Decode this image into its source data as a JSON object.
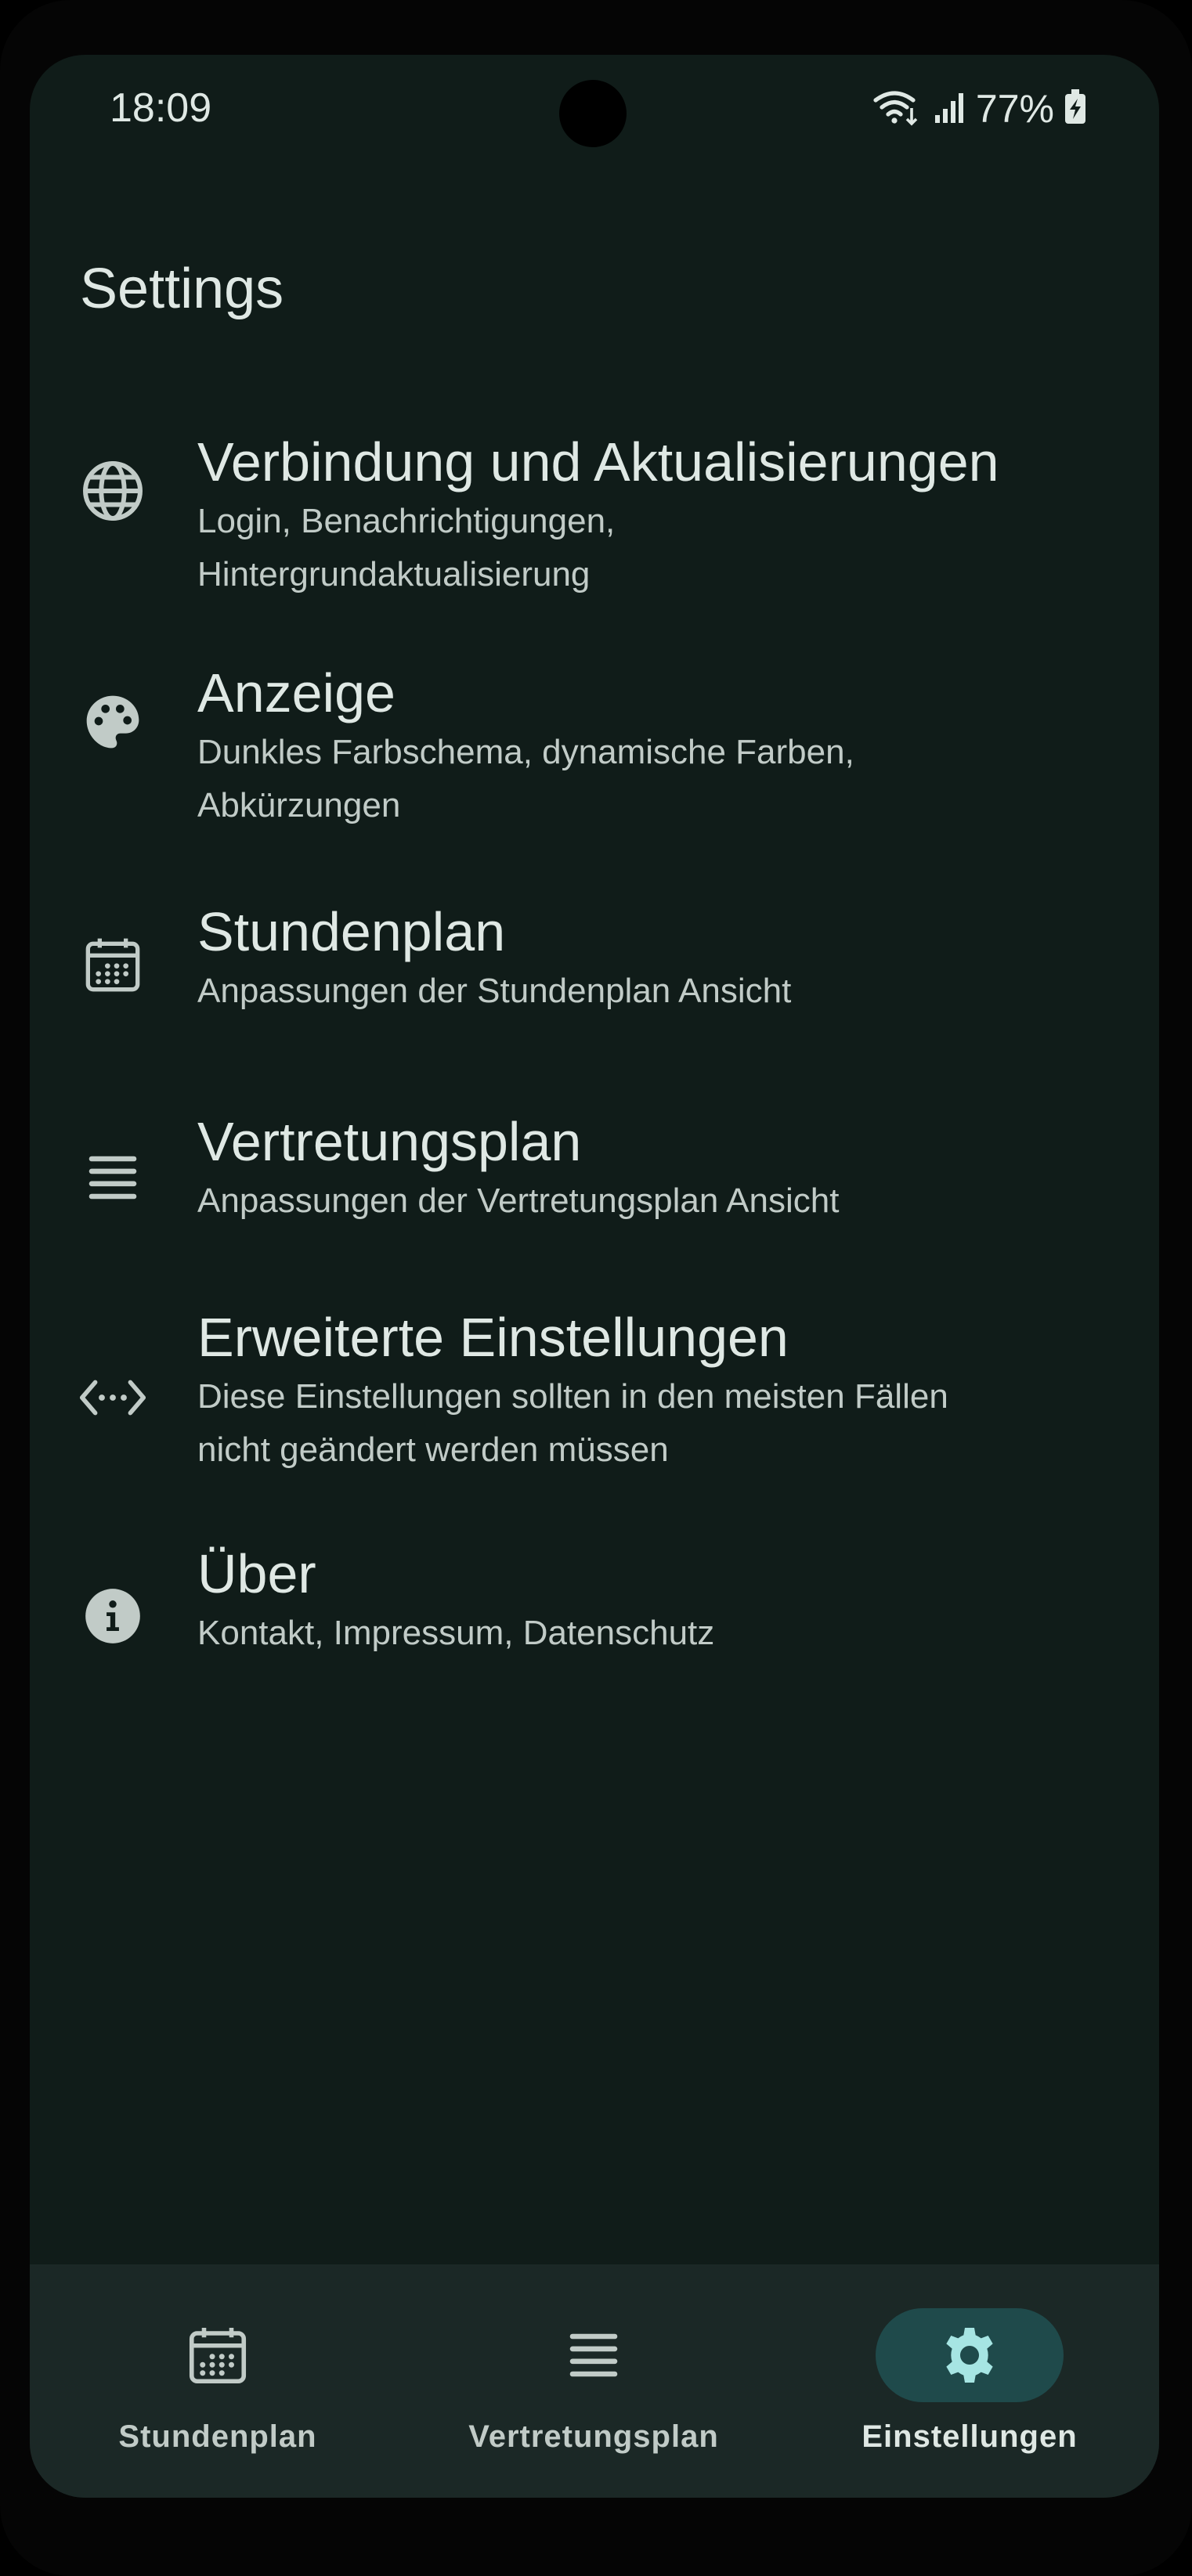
{
  "status_bar": {
    "time": "18:09",
    "battery": "77%"
  },
  "header": {
    "title": "Settings"
  },
  "settings": [
    {
      "icon": "globe-icon",
      "title": "Verbindung und Aktualisierungen",
      "subtitle_lines": [
        "Login, Benachrichtigungen,",
        "Hintergrundaktualisierung"
      ]
    },
    {
      "icon": "palette-icon",
      "title": "Anzeige",
      "subtitle_lines": [
        "Dunkles Farbschema, dynamische Farben,",
        "Abkürzungen"
      ]
    },
    {
      "icon": "calendar-icon",
      "title": "Stundenplan",
      "subtitle_lines": [
        "Anpassungen der Stundenplan Ansicht"
      ]
    },
    {
      "icon": "list-icon",
      "title": "Vertretungsplan",
      "subtitle_lines": [
        "Anpassungen der Vertretungsplan Ansicht"
      ]
    },
    {
      "icon": "code-icon",
      "title": "Erweiterte Einstellungen",
      "subtitle_lines": [
        "Diese Einstellungen sollten in den meisten Fällen",
        "nicht geändert werden müssen"
      ]
    },
    {
      "icon": "info-icon",
      "title": "Über",
      "subtitle_lines": [
        "Kontakt, Impressum, Datenschutz"
      ]
    }
  ],
  "bottom_nav": {
    "items": [
      {
        "icon": "calendar-icon",
        "label": "Stundenplan",
        "active": false
      },
      {
        "icon": "list-icon",
        "label": "Vertretungsplan",
        "active": false
      },
      {
        "icon": "gear-icon",
        "label": "Einstellungen",
        "active": true
      }
    ]
  },
  "colors": {
    "background": "#101c19",
    "nav_background": "#1b2826",
    "active_pill": "#1f4a4b",
    "active_icon": "#a6e5e3",
    "text_primary": "#dfe8e4",
    "text_secondary": "#c1cbc7"
  }
}
